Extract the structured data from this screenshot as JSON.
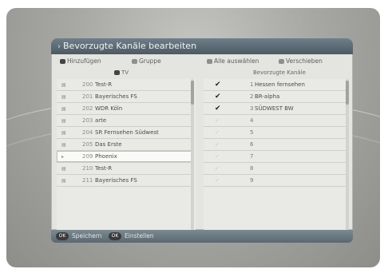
{
  "dialog": {
    "title": "Bevorzugte Kanäle bearbeiten"
  },
  "toolbar": {
    "add": "Hinzufügen",
    "group": "Gruppe",
    "select_all": "Alle auswählen",
    "move": "Verschieben"
  },
  "left": {
    "header": "TV",
    "rows": [
      {
        "num": "200",
        "name": "Test-R"
      },
      {
        "num": "201",
        "name": "Bayerisches FS"
      },
      {
        "num": "202",
        "name": "WDR Köln"
      },
      {
        "num": "203",
        "name": "arte"
      },
      {
        "num": "204",
        "name": "SR Fernsehen Südwest"
      },
      {
        "num": "205",
        "name": "Das Erste"
      },
      {
        "num": "209",
        "name": "Phoenix"
      },
      {
        "num": "210",
        "name": "Test-R"
      },
      {
        "num": "211",
        "name": "Bayerisches FS"
      }
    ]
  },
  "right": {
    "header": "Bevorzugte Kanäle",
    "rows": [
      {
        "checked": true,
        "num": "1",
        "name": "Hessen fernsehen"
      },
      {
        "checked": true,
        "num": "2",
        "name": "BR-alpha"
      },
      {
        "checked": true,
        "num": "3",
        "name": "SÜDWEST BW"
      },
      {
        "checked": false,
        "num": "4",
        "name": ""
      },
      {
        "checked": false,
        "num": "5",
        "name": ""
      },
      {
        "checked": false,
        "num": "6",
        "name": ""
      },
      {
        "checked": false,
        "num": "7",
        "name": ""
      },
      {
        "checked": false,
        "num": "8",
        "name": ""
      },
      {
        "checked": false,
        "num": "9",
        "name": ""
      }
    ]
  },
  "footer": {
    "save": "Speichern",
    "settings": "Einstellen",
    "save_key": "OK",
    "settings_key": "OK"
  },
  "icons": {
    "check": "✔",
    "empty_check": "✓",
    "arrow": "›"
  }
}
